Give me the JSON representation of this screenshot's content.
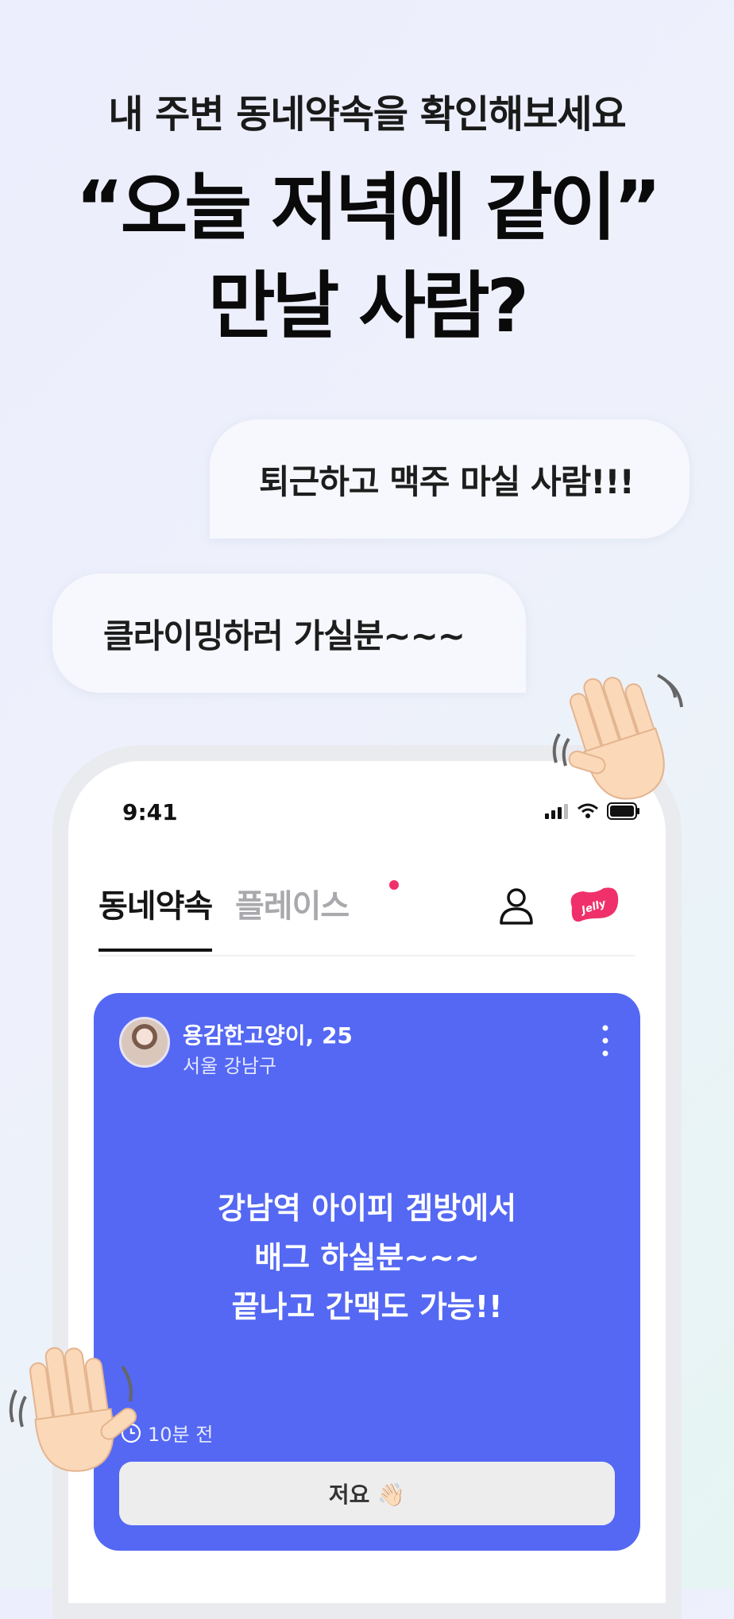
{
  "header": {
    "subtitle": "내 주변 동네약속을 확인해보세요",
    "headline_line1": "“오늘 저녁에 같이”",
    "headline_line2": "만날 사람?"
  },
  "bubbles": [
    {
      "text": "퇴근하고 맥주 마실 사람!!!"
    },
    {
      "text": "클라이밍하러 가실분~~~"
    }
  ],
  "phone": {
    "status_time": "9:41",
    "tabs": [
      {
        "label": "동네약속",
        "active": true
      },
      {
        "label": "플레이스",
        "active": false
      }
    ],
    "jelly_label": "Jelly",
    "post": {
      "author": "용감한고양이, 25",
      "location": "서울 강남구",
      "text_lines": [
        "강남역 아이피 겜방에서",
        "배그 하실분~~~",
        "끝나고 간맥도 가능!!"
      ],
      "posted_time": "10분 전",
      "join_label": "저요 👋🏻"
    }
  },
  "colors": {
    "card": "#5468f3",
    "notification_dot": "#f0306a",
    "jelly": "#f0306a"
  },
  "icons": [
    "signal-icon",
    "wifi-icon",
    "battery-icon",
    "user-icon",
    "jelly-icon",
    "more-icon",
    "clock-icon",
    "waving-hand-icon"
  ]
}
